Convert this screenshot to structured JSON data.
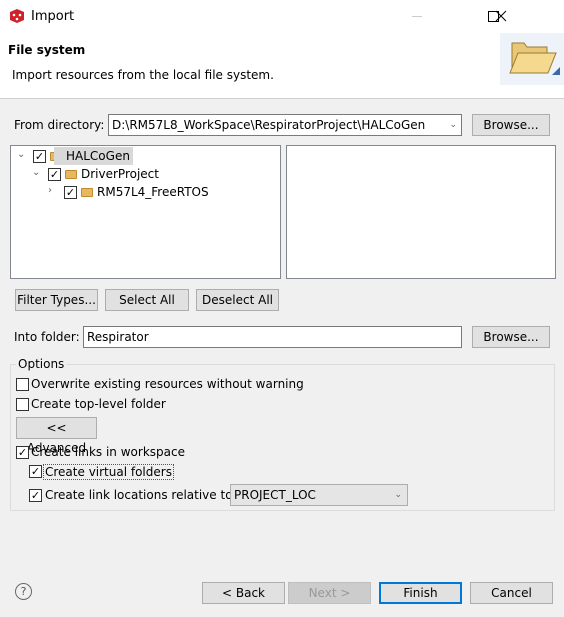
{
  "window": {
    "title": "Import",
    "minimize_icon": "minimize-icon",
    "maximize_icon": "maximize-icon",
    "close_icon": "close-icon"
  },
  "header": {
    "title": "File system",
    "description": "Import resources from the local file system."
  },
  "from_directory": {
    "label": "From directory:",
    "value": "D:\\RM57L8_WorkSpace\\RespiratorProject\\HALCoGen",
    "browse": "Browse..."
  },
  "tree": [
    {
      "label": "HALCoGen",
      "checked": true,
      "expanded": true
    },
    {
      "label": "DriverProject",
      "checked": true,
      "expanded": true
    },
    {
      "label": "RM57L4_FreeRTOS",
      "checked": true,
      "expanded": false
    }
  ],
  "buttons": {
    "filter_types": "Filter Types...",
    "select_all": "Select All",
    "deselect_all": "Deselect All"
  },
  "into_folder": {
    "label": "Into folder:",
    "value": "Respirator",
    "browse": "Browse..."
  },
  "options": {
    "title": "Options",
    "overwrite": "Overwrite existing resources without warning",
    "top_level": "Create top-level folder",
    "advanced": "<< Advanced",
    "create_links": "Create links in workspace",
    "virtual_folders": "Create virtual folders",
    "relative_to": "Create link locations relative to:",
    "relative_value": "PROJECT_LOC"
  },
  "footer": {
    "back": "< Back",
    "next": "Next >",
    "finish": "Finish",
    "cancel": "Cancel"
  }
}
